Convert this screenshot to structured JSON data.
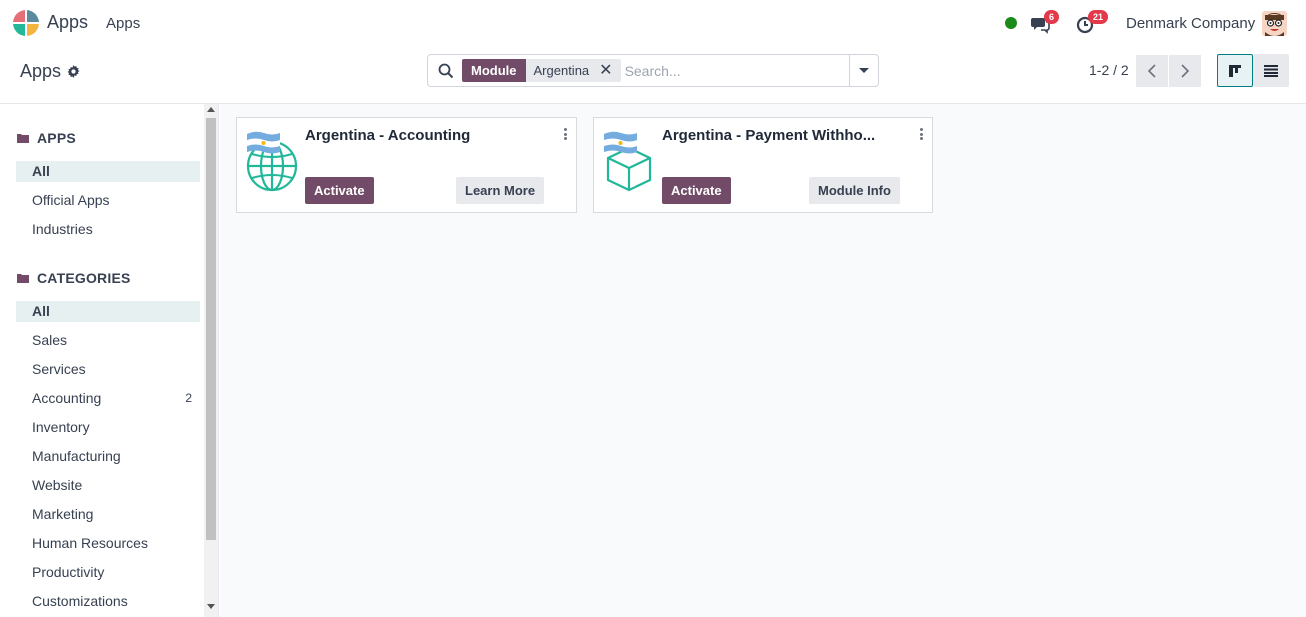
{
  "navbar": {
    "app_name": "Apps",
    "menu_apps": "Apps",
    "messages_count": "6",
    "activities_count": "21",
    "company": "Denmark Company",
    "presence_color": "#1a8a1a"
  },
  "control_panel": {
    "breadcrumb": "Apps",
    "search": {
      "facet_label": "Module",
      "facet_value": "Argentina",
      "placeholder": "Search..."
    },
    "pager": "1-2 / 2"
  },
  "sidebar": {
    "apps_title": "APPS",
    "apps_items": [
      {
        "label": "All",
        "active": true
      },
      {
        "label": "Official Apps"
      },
      {
        "label": "Industries"
      }
    ],
    "categories_title": "CATEGORIES",
    "categories_items": [
      {
        "label": "All",
        "active": true
      },
      {
        "label": "Sales"
      },
      {
        "label": "Services"
      },
      {
        "label": "Accounting",
        "count": "2"
      },
      {
        "label": "Inventory"
      },
      {
        "label": "Manufacturing"
      },
      {
        "label": "Website"
      },
      {
        "label": "Marketing"
      },
      {
        "label": "Human Resources"
      },
      {
        "label": "Productivity"
      },
      {
        "label": "Customizations"
      }
    ]
  },
  "cards": [
    {
      "title": "Argentina - Accounting",
      "icon": "globe-icon",
      "primary": "Activate",
      "secondary": "Learn More"
    },
    {
      "title": "Argentina - Payment Withho...",
      "icon": "box-icon",
      "primary": "Activate",
      "secondary": "Module Info"
    }
  ],
  "colors": {
    "primary": "#714b67",
    "accent": "#017e84",
    "icon_teal": "#21b799",
    "badge": "#e3394a"
  }
}
